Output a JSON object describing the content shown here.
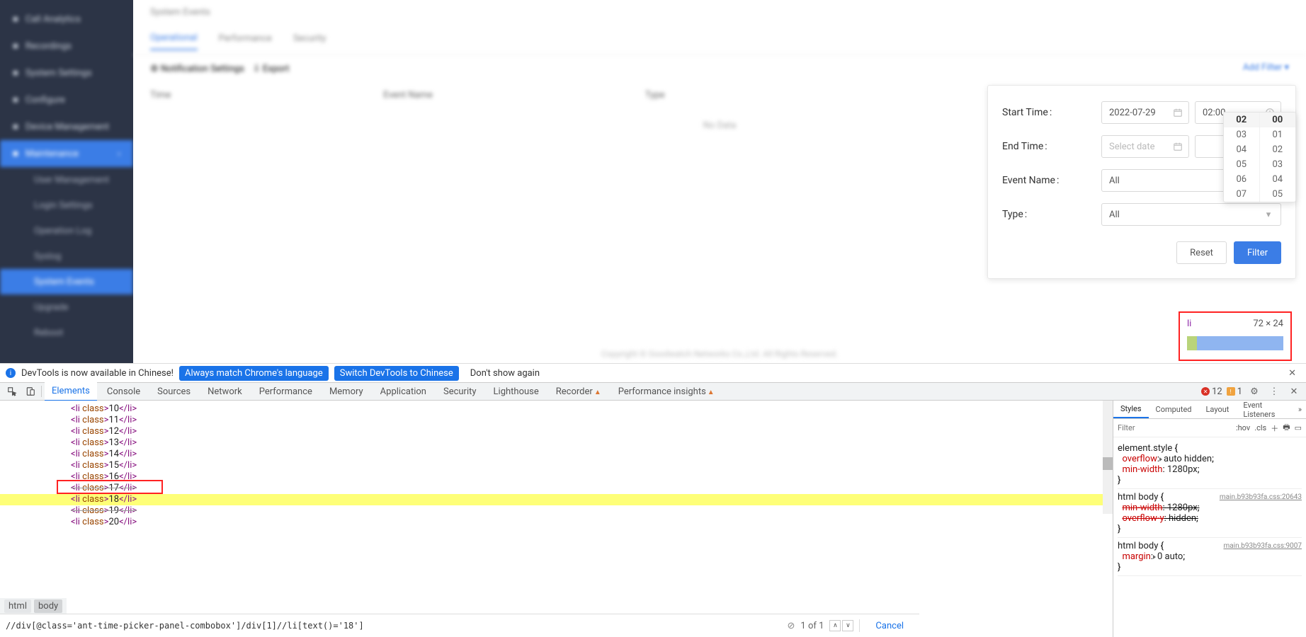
{
  "sidebar": {
    "items": [
      "Call Analytics",
      "Recordings",
      "System Settings",
      "Configure",
      "Device Management",
      "Maintenance"
    ],
    "subs": [
      "User Management",
      "Login Settings",
      "Operation Log",
      "Syslog",
      "System Events",
      "Upgrade",
      "Reboot"
    ]
  },
  "page": {
    "crumb": "System Events",
    "tab1": "Operational",
    "tab2": "Performance",
    "tab3": "Security",
    "btn1": "Notification Settings",
    "btn2": "Export",
    "addfilter": "Add Filter",
    "th1": "Time",
    "th2": "Event Name",
    "th3": "Type",
    "empty": "No Data",
    "copy": "Copyright © Goodwatch Networks Co.,Ltd. All Rights Reserved."
  },
  "filter": {
    "start_label": "Start Time",
    "end_label": "End Time",
    "ev_label": "Event Name",
    "type_label": "Type",
    "start_date": "2022-07-29",
    "start_time": "02:00",
    "end_date_ph": "Select date",
    "end_time": "",
    "event_val": "All",
    "type_val": "All",
    "reset": "Reset",
    "apply": "Filter",
    "hours": [
      "02",
      "03",
      "04",
      "05",
      "06",
      "07"
    ],
    "mins": [
      "00",
      "01",
      "02",
      "03",
      "04",
      "05"
    ]
  },
  "inspect_tip": {
    "el": "li",
    "dim": "72 × 24"
  },
  "notice": {
    "msg": "DevTools is now available in Chinese!",
    "chip1": "Always match Chrome's language",
    "chip2": "Switch DevTools to Chinese",
    "chip3": "Don't show again"
  },
  "devtabs": {
    "items": [
      "Elements",
      "Console",
      "Sources",
      "Network",
      "Performance",
      "Memory",
      "Application",
      "Security",
      "Lighthouse",
      "Recorder",
      "Performance insights"
    ],
    "err": "12",
    "warn": "1"
  },
  "dom_lines": [
    {
      "n": "10",
      "cls": ""
    },
    {
      "n": "11",
      "cls": ""
    },
    {
      "n": "12",
      "cls": ""
    },
    {
      "n": "13",
      "cls": ""
    },
    {
      "n": "14",
      "cls": ""
    },
    {
      "n": "15",
      "cls": ""
    },
    {
      "n": "16",
      "cls": ""
    },
    {
      "n": "17",
      "cls": "strike"
    },
    {
      "n": "18",
      "cls": "hl"
    },
    {
      "n": "19",
      "cls": "strike"
    },
    {
      "n": "20",
      "cls": ""
    }
  ],
  "bcrumb": [
    "html",
    "body"
  ],
  "find": {
    "q": "//div[@class='ant-time-picker-panel-combobox']/div[1]//li[text()='18']",
    "count": "1 of 1",
    "cancel": "Cancel"
  },
  "styles": {
    "tabs": [
      "Styles",
      "Computed",
      "Layout",
      "Event Listeners"
    ],
    "filter_ph": "Filter",
    "hov": ":hov",
    "cls": ".cls",
    "r1_sel": "element.style",
    "r1_p1": "overflow",
    "r1_v1": "auto hidden",
    "r1_p2": "min-width",
    "r1_v2": "1280px",
    "r2_sel": "html body",
    "r2_src": "main.b93b93fa.css:20643",
    "r2_p1": "min-width",
    "r2_v1": "1280px",
    "r2_p2": "overflow-y",
    "r2_v2": "hidden",
    "r3_sel": "html body",
    "r3_src": "main.b93b93fa.css:9007",
    "r3_p1": "margin",
    "r3_v1": "0 auto"
  }
}
